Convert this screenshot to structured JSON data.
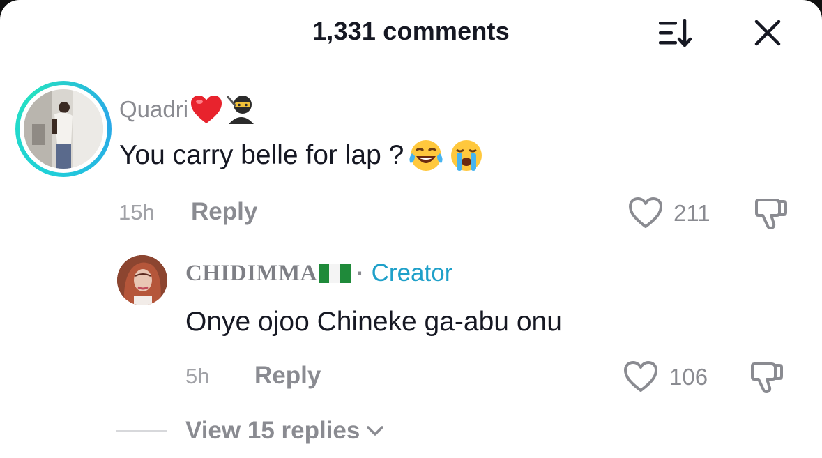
{
  "header": {
    "title": "1,331 comments",
    "sort_icon": "sort-descending-icon",
    "close_icon": "close-icon"
  },
  "comments": [
    {
      "username": "Quadri",
      "username_emojis": [
        "red-heart",
        "ninja"
      ],
      "avatar_ring_color": "#1fd0d8",
      "text": "You carry belle for lap ?",
      "text_emojis": [
        "face-with-tears-of-joy",
        "loudly-crying-face"
      ],
      "time": "15h",
      "reply_label": "Reply",
      "likes": "211",
      "like_icon": "heart-outline-icon",
      "dislike_icon": "thumbs-down-icon"
    },
    {
      "username": "CHIDIMMA",
      "username_emojis": [
        "nigeria-flag"
      ],
      "badge": "Creator",
      "badge_color": "#1fa0c9",
      "text": "Onye ojoo Chineke ga-abu onu",
      "time": "5h",
      "reply_label": "Reply",
      "likes": "106",
      "like_icon": "heart-outline-icon",
      "dislike_icon": "thumbs-down-icon"
    }
  ],
  "view_replies": {
    "label": "View 15 replies",
    "icon": "chevron-down-icon"
  }
}
